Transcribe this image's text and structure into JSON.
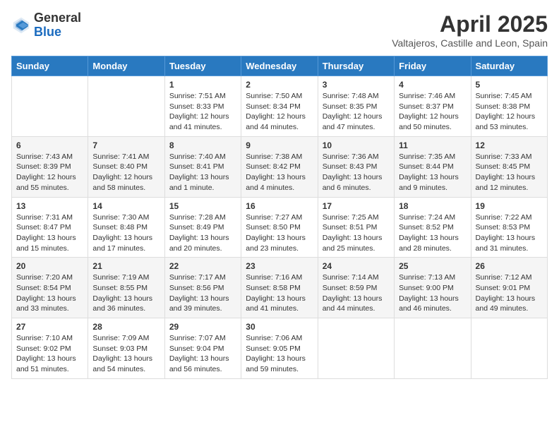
{
  "logo": {
    "general": "General",
    "blue": "Blue"
  },
  "title": "April 2025",
  "subtitle": "Valtajeros, Castille and Leon, Spain",
  "days_of_week": [
    "Sunday",
    "Monday",
    "Tuesday",
    "Wednesday",
    "Thursday",
    "Friday",
    "Saturday"
  ],
  "weeks": [
    [
      {
        "day": "",
        "content": ""
      },
      {
        "day": "",
        "content": ""
      },
      {
        "day": "1",
        "content": "Sunrise: 7:51 AM\nSunset: 8:33 PM\nDaylight: 12 hours and 41 minutes."
      },
      {
        "day": "2",
        "content": "Sunrise: 7:50 AM\nSunset: 8:34 PM\nDaylight: 12 hours and 44 minutes."
      },
      {
        "day": "3",
        "content": "Sunrise: 7:48 AM\nSunset: 8:35 PM\nDaylight: 12 hours and 47 minutes."
      },
      {
        "day": "4",
        "content": "Sunrise: 7:46 AM\nSunset: 8:37 PM\nDaylight: 12 hours and 50 minutes."
      },
      {
        "day": "5",
        "content": "Sunrise: 7:45 AM\nSunset: 8:38 PM\nDaylight: 12 hours and 53 minutes."
      }
    ],
    [
      {
        "day": "6",
        "content": "Sunrise: 7:43 AM\nSunset: 8:39 PM\nDaylight: 12 hours and 55 minutes."
      },
      {
        "day": "7",
        "content": "Sunrise: 7:41 AM\nSunset: 8:40 PM\nDaylight: 12 hours and 58 minutes."
      },
      {
        "day": "8",
        "content": "Sunrise: 7:40 AM\nSunset: 8:41 PM\nDaylight: 13 hours and 1 minute."
      },
      {
        "day": "9",
        "content": "Sunrise: 7:38 AM\nSunset: 8:42 PM\nDaylight: 13 hours and 4 minutes."
      },
      {
        "day": "10",
        "content": "Sunrise: 7:36 AM\nSunset: 8:43 PM\nDaylight: 13 hours and 6 minutes."
      },
      {
        "day": "11",
        "content": "Sunrise: 7:35 AM\nSunset: 8:44 PM\nDaylight: 13 hours and 9 minutes."
      },
      {
        "day": "12",
        "content": "Sunrise: 7:33 AM\nSunset: 8:45 PM\nDaylight: 13 hours and 12 minutes."
      }
    ],
    [
      {
        "day": "13",
        "content": "Sunrise: 7:31 AM\nSunset: 8:47 PM\nDaylight: 13 hours and 15 minutes."
      },
      {
        "day": "14",
        "content": "Sunrise: 7:30 AM\nSunset: 8:48 PM\nDaylight: 13 hours and 17 minutes."
      },
      {
        "day": "15",
        "content": "Sunrise: 7:28 AM\nSunset: 8:49 PM\nDaylight: 13 hours and 20 minutes."
      },
      {
        "day": "16",
        "content": "Sunrise: 7:27 AM\nSunset: 8:50 PM\nDaylight: 13 hours and 23 minutes."
      },
      {
        "day": "17",
        "content": "Sunrise: 7:25 AM\nSunset: 8:51 PM\nDaylight: 13 hours and 25 minutes."
      },
      {
        "day": "18",
        "content": "Sunrise: 7:24 AM\nSunset: 8:52 PM\nDaylight: 13 hours and 28 minutes."
      },
      {
        "day": "19",
        "content": "Sunrise: 7:22 AM\nSunset: 8:53 PM\nDaylight: 13 hours and 31 minutes."
      }
    ],
    [
      {
        "day": "20",
        "content": "Sunrise: 7:20 AM\nSunset: 8:54 PM\nDaylight: 13 hours and 33 minutes."
      },
      {
        "day": "21",
        "content": "Sunrise: 7:19 AM\nSunset: 8:55 PM\nDaylight: 13 hours and 36 minutes."
      },
      {
        "day": "22",
        "content": "Sunrise: 7:17 AM\nSunset: 8:56 PM\nDaylight: 13 hours and 39 minutes."
      },
      {
        "day": "23",
        "content": "Sunrise: 7:16 AM\nSunset: 8:58 PM\nDaylight: 13 hours and 41 minutes."
      },
      {
        "day": "24",
        "content": "Sunrise: 7:14 AM\nSunset: 8:59 PM\nDaylight: 13 hours and 44 minutes."
      },
      {
        "day": "25",
        "content": "Sunrise: 7:13 AM\nSunset: 9:00 PM\nDaylight: 13 hours and 46 minutes."
      },
      {
        "day": "26",
        "content": "Sunrise: 7:12 AM\nSunset: 9:01 PM\nDaylight: 13 hours and 49 minutes."
      }
    ],
    [
      {
        "day": "27",
        "content": "Sunrise: 7:10 AM\nSunset: 9:02 PM\nDaylight: 13 hours and 51 minutes."
      },
      {
        "day": "28",
        "content": "Sunrise: 7:09 AM\nSunset: 9:03 PM\nDaylight: 13 hours and 54 minutes."
      },
      {
        "day": "29",
        "content": "Sunrise: 7:07 AM\nSunset: 9:04 PM\nDaylight: 13 hours and 56 minutes."
      },
      {
        "day": "30",
        "content": "Sunrise: 7:06 AM\nSunset: 9:05 PM\nDaylight: 13 hours and 59 minutes."
      },
      {
        "day": "",
        "content": ""
      },
      {
        "day": "",
        "content": ""
      },
      {
        "day": "",
        "content": ""
      }
    ]
  ]
}
